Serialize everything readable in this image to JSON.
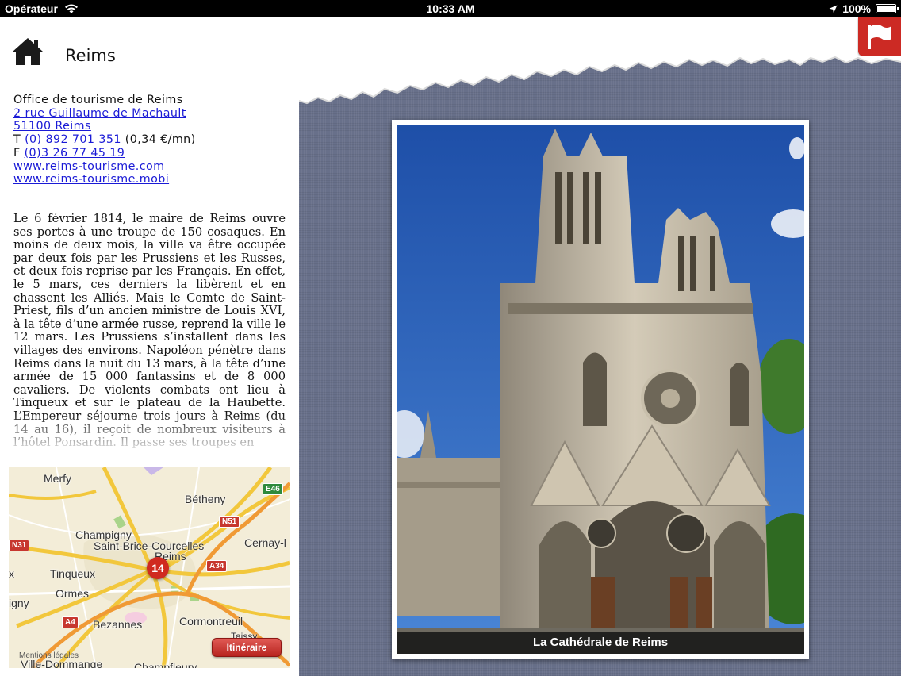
{
  "status_bar": {
    "carrier": "Opérateur",
    "time": "10:33 AM",
    "battery": "100%"
  },
  "header": {
    "title": "Reims",
    "home_icon": "home-icon",
    "flag_icon": "flag-icon"
  },
  "contact": {
    "office": "Office de tourisme de Reims",
    "street": "2 rue Guillaume de Machault",
    "city": "51100 Reims",
    "tel_prefix": "T ",
    "tel": "(0) 892 701 351",
    "tel_rate": " (0,34 €/mn)",
    "fax_prefix": "F ",
    "fax": "(0)3 26 77 45 19",
    "web1": "www.reims-tourisme.com",
    "web2": "www.reims-tourisme.mobi"
  },
  "article": {
    "text": "Le 6 février 1814, le maire de Reims ouvre ses portes à une troupe de 150 cosaques. En moins de deux mois, la ville va être occupée par deux fois par les Prussiens et les Russes, et deux fois reprise par les Français. En effet, le 5 mars, ces derniers la libèrent et en chassent les Alliés. Mais le Comte de Saint-Priest, fils d’un ancien ministre de Louis XVI, à la tête d’une armée russe, reprend la ville le 12 mars. Les Prussiens s’installent dans les villages des environs. Napoléon pénètre dans Reims dans la nuit du 13 mars, à la tête d’une armée de 15 000 fantassins et de 8 000 cavaliers. De violents combats ont lieu à Tinqueux et sur le plateau de la Haubette. L’Empereur séjourne trois jours à Reims (du 14 au 16), il reçoit de nombreux visiteurs à l’hôtel Ponsardin. Il passe ses troupes en"
  },
  "map": {
    "places": {
      "merfy": "Merfy",
      "betheny": "Bétheny",
      "champigny": "Champigny",
      "saint_brice": "Saint-Brice-Courcelles",
      "reims": "Reims",
      "cernay": "Cernay-l",
      "tinqueux": "Tinqueux",
      "ormes": "Ormes",
      "gny": "igny",
      "bezannes": "Bezannes",
      "cormontreuil": "Cormontreuil",
      "ville_dommange": "Ville-Dommange",
      "taissy": "Taissy",
      "champfleury": "Champfleury",
      "sixx": "x"
    },
    "roads": {
      "e46": "E46",
      "n51": "N51",
      "n31": "N31",
      "a34": "A34",
      "a4": "A4"
    },
    "pin_count": "14",
    "legal": "Mentions légales",
    "itinerary_button": "Itinéraire"
  },
  "photo": {
    "caption": "La Cathédrale de Reims"
  },
  "colors": {
    "accent_red": "#cc2a24",
    "link_blue": "#1a1ad6",
    "panel_slate": "#68708a"
  }
}
